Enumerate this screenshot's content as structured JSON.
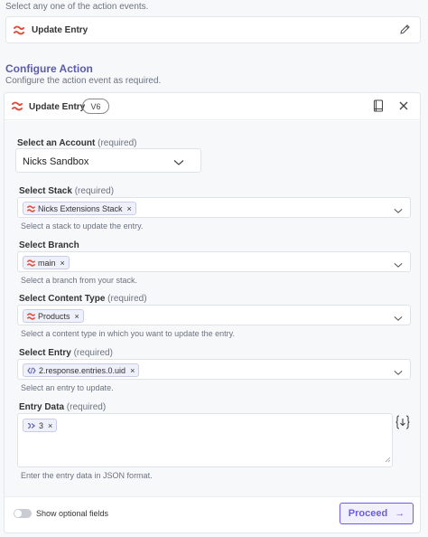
{
  "top_hint": "Select any one of the action events.",
  "event_card": {
    "title": "Update Entry"
  },
  "configure": {
    "title": "Configure Action",
    "subtitle": "Configure the action event as required."
  },
  "panel": {
    "title": "Update Entry",
    "version": "V6"
  },
  "account": {
    "label": "Select an Account",
    "required": "(required)",
    "value": "Nicks Sandbox"
  },
  "stack": {
    "label": "Select Stack",
    "required": "(required)",
    "chip": "Nicks Extensions Stack",
    "help": "Select a stack to update the entry."
  },
  "branch": {
    "label": "Select Branch",
    "required": "",
    "chip": "main",
    "help": "Select a branch from your stack."
  },
  "content_type": {
    "label": "Select Content Type",
    "required": "(required)",
    "chip": "Products",
    "help": "Select a content type in which you want to update the entry."
  },
  "entry": {
    "label": "Select Entry",
    "required": "(required)",
    "chip": "2.response.entries.0.uid",
    "help": "Select an entry to update."
  },
  "entry_data": {
    "label": "Entry Data",
    "required": "(required)",
    "chip": "3",
    "help": "Enter the entry data in JSON format."
  },
  "footer": {
    "toggle_label": "Show optional fields",
    "proceed_label": "Proceed",
    "proceed_arrow": "→"
  },
  "colors": {
    "accent": "#6c5ce7",
    "brand_red": "#e2513f",
    "section_title": "#5b5bb7"
  }
}
